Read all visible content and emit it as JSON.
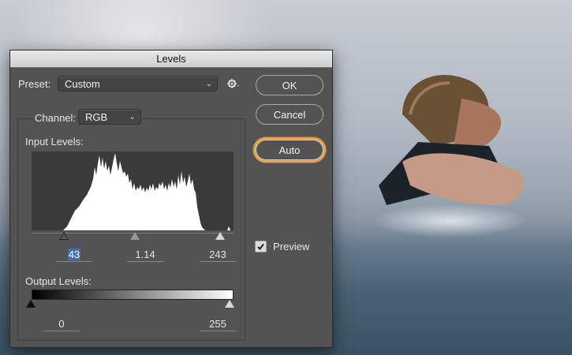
{
  "dialog": {
    "title": "Levels",
    "preset_label": "Preset:",
    "preset_value": "Custom",
    "channel_label": "Channel:",
    "channel_value": "RGB",
    "input_levels_label": "Input Levels:",
    "output_levels_label": "Output Levels:",
    "input_black": "43",
    "input_gamma": "1.14",
    "input_white": "243",
    "output_black": "0",
    "output_white": "255",
    "ok_label": "OK",
    "cancel_label": "Cancel",
    "auto_label": "Auto",
    "preview_label": "Preview",
    "preview_checked": true,
    "accent_highlight": "#e8a24d",
    "selection_color": "#3f6fb5"
  },
  "icons": {
    "preset_options": "gear-icon",
    "dropdown": "chevron-updown-icon",
    "check": "checkmark-icon"
  }
}
